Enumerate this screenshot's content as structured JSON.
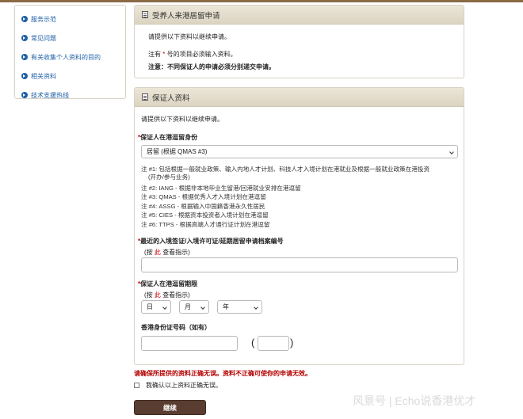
{
  "sidebar": {
    "items": [
      {
        "label": "服务示范"
      },
      {
        "label": "常见问题"
      },
      {
        "label": "有关收集个人资料的目的"
      },
      {
        "label": "相关资料"
      },
      {
        "label": "技术支援热线"
      }
    ]
  },
  "section1": {
    "title": "受养人来港居留申请",
    "intro": "请提供以下资料以继续申请。",
    "required_prefix": "注有",
    "required_star": "*",
    "required_suffix": "号的项目必须输入资料。",
    "notice": "注意：不同保证人的申请必须分别递交申请。"
  },
  "section2": {
    "title": "保证人资料",
    "intro": "请提供以下资料以继续申请。",
    "status": {
      "label": "保证人在港逗留身份",
      "selected": "居留 (根据 QMAS #3)"
    },
    "notes": [
      "注 #1: 包括根据一般就业政策、输入内地人才计划、科技人才入境计划在港就业及根据一般就业政策在港投资",
      "(开办/参与业务)",
      "注 #2: IANG - 根据非本地毕业生留港/回港就业安排在港逗留",
      "注 #3: QMAS - 根据优秀人才入境计划在港逗留",
      "注 #4: ASSG - 根据输入中国籍香港永久性居民",
      "注 #5: CIES - 根据资本投资者入境计划在港逗留",
      "注 #6: TTPS - 根据高端人才通行证计划在港逗留"
    ],
    "ref_no": {
      "label": "最近的入境签证/入境许可证/延期居留申请档案编号",
      "hint_prefix": "(按",
      "hint_link": "此",
      "hint_suffix": "查看指示)",
      "value": ""
    },
    "limit": {
      "label": "保证人在港逗留期限",
      "hint_prefix": "(按",
      "hint_link": "此",
      "hint_suffix": "查看指示)",
      "day": "日",
      "month": "月",
      "year": "年"
    },
    "hkid": {
      "label": "香港身份证号码（如有）",
      "open_paren": "(",
      "close_paren": ")"
    }
  },
  "footer": {
    "warning": "请确保所提供的资料正确无误。资料不正确可使你的申请无效。",
    "confirm": "我确认以上资料正确无误。",
    "continue": "继续"
  },
  "watermark": "风景号 | Echo说香港优才",
  "colors": {
    "accent_link": "#1d5fa6",
    "warning": "#b40000",
    "button": "#5a3d31"
  }
}
